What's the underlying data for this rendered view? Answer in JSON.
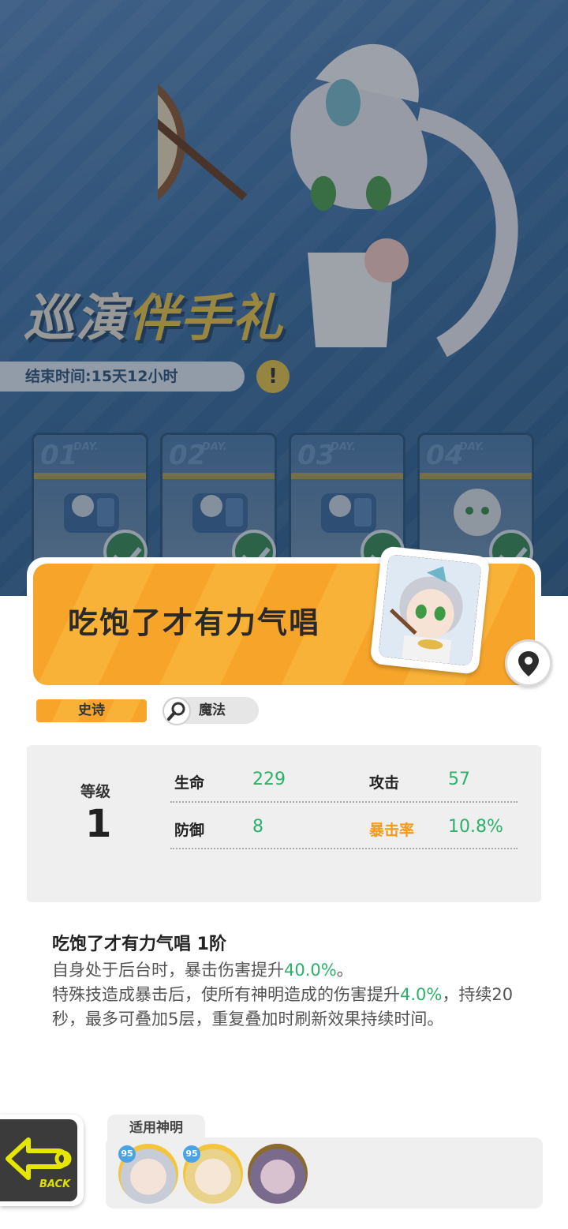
{
  "banner": {
    "title_main": "巡演",
    "title_accent": "伴手礼",
    "end_time": "结束时间:15天12小时",
    "warn_icon": "!",
    "days": [
      {
        "num": "01",
        "word": "DAY.",
        "claimed": true
      },
      {
        "num": "02",
        "word": "DAY.",
        "claimed": true
      },
      {
        "num": "03",
        "word": "DAY.",
        "claimed": true
      },
      {
        "num": "04",
        "word": "DAY.",
        "claimed": true
      }
    ]
  },
  "item": {
    "name": "吃饱了才有力气唱",
    "rarity": "史诗",
    "type": "魔法",
    "type_icon": "magnifier-icon"
  },
  "stats": {
    "level_label": "等级",
    "level_value": "1",
    "hp_label": "生命",
    "hp_value": "229",
    "atk_label": "攻击",
    "atk_value": "57",
    "def_label": "防御",
    "def_value": "8",
    "crit_label": "暴击率",
    "crit_value": "10.8%"
  },
  "skill": {
    "title": "吃饱了才有力气唱 1阶",
    "line1_pre": "自身处于后台时，暴击伤害提升",
    "line1_hl": "40.0%",
    "line1_post": "。",
    "line2_pre": "特殊技造成暴击后，使所有神明造成的伤害提升",
    "line2_hl": "4.0%",
    "line2_post": "，持续20秒，最多可叠加5层，重复叠加时刷新效果持续时间。"
  },
  "back": {
    "label": "BACK",
    "icon": "back-arrow-icon"
  },
  "deities": {
    "title": "适用神明",
    "list": [
      {
        "level": "95",
        "color": "#f4c53a"
      },
      {
        "level": "95",
        "color": "#f4c53a"
      },
      {
        "level": "",
        "color": "#8b6a2e"
      }
    ]
  },
  "colors": {
    "accent_orange": "#f7a52a",
    "value_green": "#2bb16a",
    "crit_orange": "#f39a1a"
  }
}
